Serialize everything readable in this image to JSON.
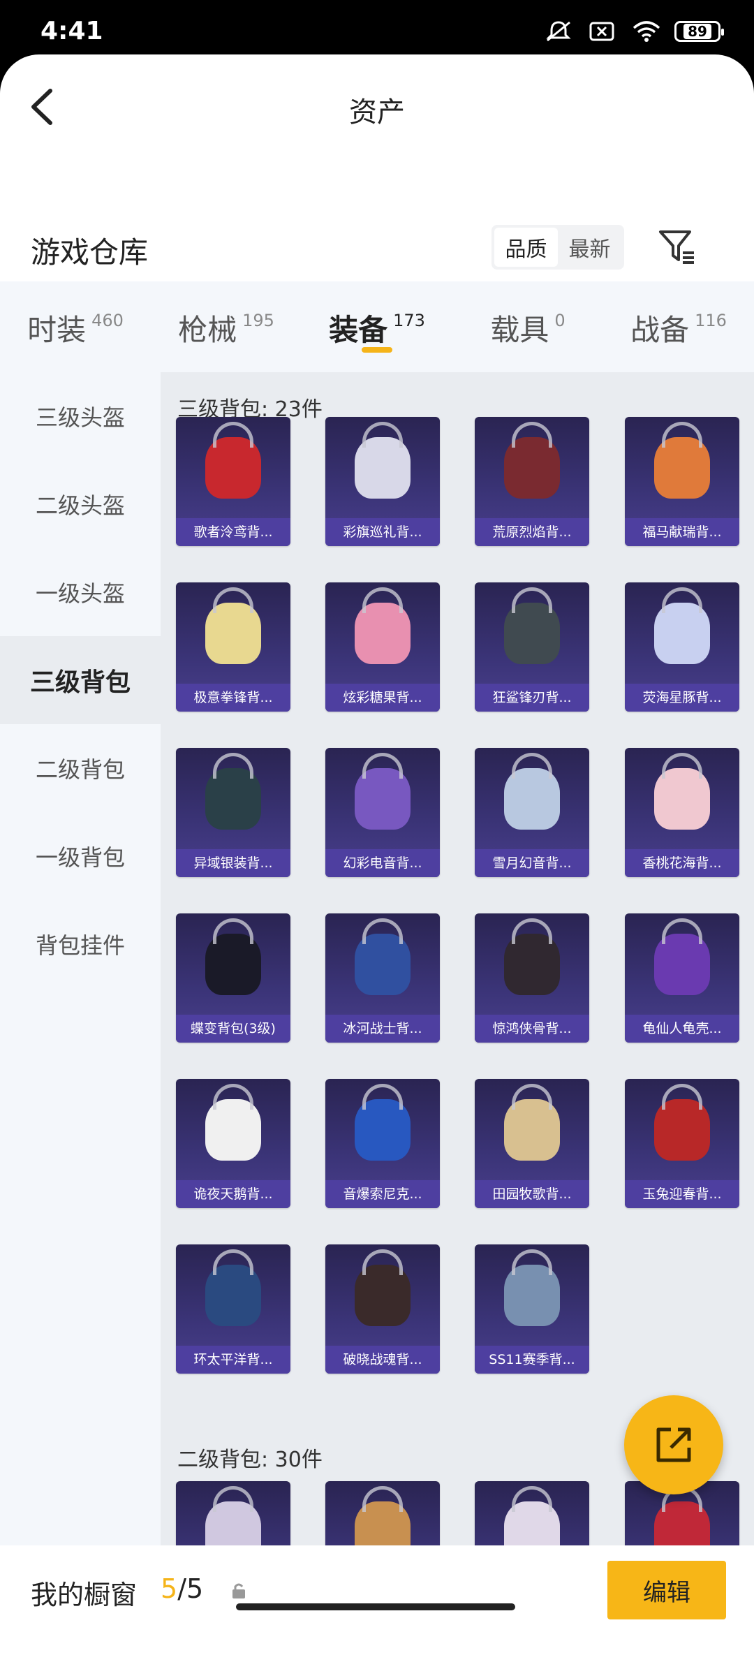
{
  "status_bar": {
    "time": "4:41",
    "battery": "89"
  },
  "header": {
    "title": "资产"
  },
  "warehouse": {
    "title": "游戏仓库",
    "sort_quality": "品质",
    "sort_newest": "最新"
  },
  "tabs": [
    {
      "label": "时装",
      "count": "460"
    },
    {
      "label": "枪械",
      "count": "195"
    },
    {
      "label": "装备",
      "count": "173"
    },
    {
      "label": "载具",
      "count": "0"
    },
    {
      "label": "战备",
      "count": "116"
    }
  ],
  "sidebar": [
    "三级头盔",
    "二级头盔",
    "一级头盔",
    "三级背包",
    "二级背包",
    "一级背包",
    "背包挂件"
  ],
  "sections": [
    {
      "title": "三级背包: 23件",
      "items": [
        "歌者泠鸢背...",
        "彩旗巡礼背...",
        "荒原烈焰背...",
        "福马献瑞背...",
        "极意拳锋背...",
        "炫彩糖果背...",
        "狂鲨锋刃背...",
        "荧海星豚背...",
        "异域银装背...",
        "幻彩电音背...",
        "雪月幻音背...",
        "香桃花海背...",
        "蝶变背包(3级)",
        "冰河战士背...",
        "惊鸿侠骨背...",
        "龟仙人龟壳...",
        "诡夜天鹅背...",
        "音爆索尼克...",
        "田园牧歌背...",
        "玉兔迎春背...",
        "环太平洋背...",
        "破晓战魂背...",
        "SS11赛季背..."
      ]
    },
    {
      "title": "二级背包: 30件"
    }
  ],
  "item_colors": [
    "#c8282e",
    "#d8d8e8",
    "#7a2a30",
    "#e07a3a",
    "#e8d890",
    "#e890b0",
    "#404a50",
    "#c8d0f0",
    "#2a4048",
    "#7858c0",
    "#b8c8e0",
    "#f0c8d0",
    "#1a1a28",
    "#3050a0",
    "#302830",
    "#6a3ab0",
    "#f0f0f0",
    "#2858c0",
    "#d8c090",
    "#b82828",
    "#2a4a80",
    "#3a2a2a",
    "#7890b0",
    "#d0c8e0",
    "#c89050",
    "#e0d8e8",
    "#c02838"
  ],
  "bottom": {
    "showcase_label": "我的橱窗",
    "current": "5",
    "total": "/5",
    "edit": "编辑"
  }
}
